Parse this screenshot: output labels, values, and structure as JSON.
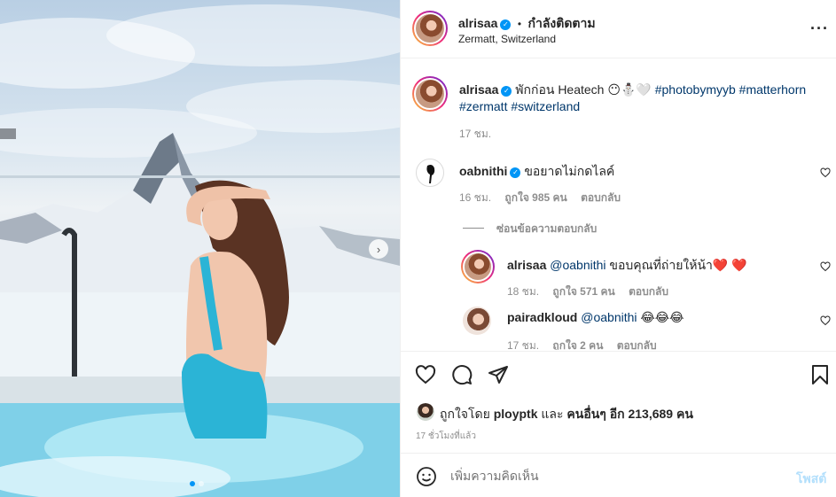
{
  "post": {
    "author": "alrisaa",
    "follow_label": "กำลังติดตาม",
    "dot_separator": "•",
    "location": "Zermatt, Switzerland",
    "more_icon": "more-horizontal-icon"
  },
  "caption": {
    "author": "alrisaa",
    "text": "พักก่อน Heatech",
    "emojis": "😶⛄🤍",
    "hashtags_line1": "#photobymyyb #matterhorn",
    "hashtags_line2": "#zermatt #switzerland",
    "time": "17 ชม."
  },
  "comments": [
    {
      "author": "oabnithi",
      "text": "ขอยาดไม่กดไลค์",
      "time": "16 ชม.",
      "likes": "ถูกใจ 985 คน",
      "reply_label": "ตอบกลับ",
      "hide_replies": "ซ่อนข้อความตอบกลับ"
    }
  ],
  "replies": [
    {
      "author": "alrisaa",
      "mention": "@oabnithi",
      "text": "ขอบคุณที่ถ่ายให้น้า",
      "emojis": "❤️ ❤️",
      "time": "18 ชม.",
      "likes": "ถูกใจ 571 คน",
      "reply_label": "ตอบกลับ"
    },
    {
      "author": "pairadkloud",
      "mention": "@oabnithi",
      "emojis": "😂😂😂",
      "time": "17 ชม.",
      "likes": "ถูกใจ 2 คน",
      "reply_label": "ตอบกลับ"
    }
  ],
  "likes_summary": {
    "prefix": "ถูกใจโดย",
    "user": "ployptk",
    "middle": "และ",
    "others": "คนอื่นๆ อีก 213,689 คน"
  },
  "posted_ago": "17 ชั่วโมงที่แล้ว",
  "comment_box": {
    "placeholder": "เพิ่มความคิดเห็น",
    "post_label": "โพสต์"
  },
  "colors": {
    "accent": "#0095f6",
    "hashtag": "#00376b",
    "muted": "#8e8e8e"
  }
}
